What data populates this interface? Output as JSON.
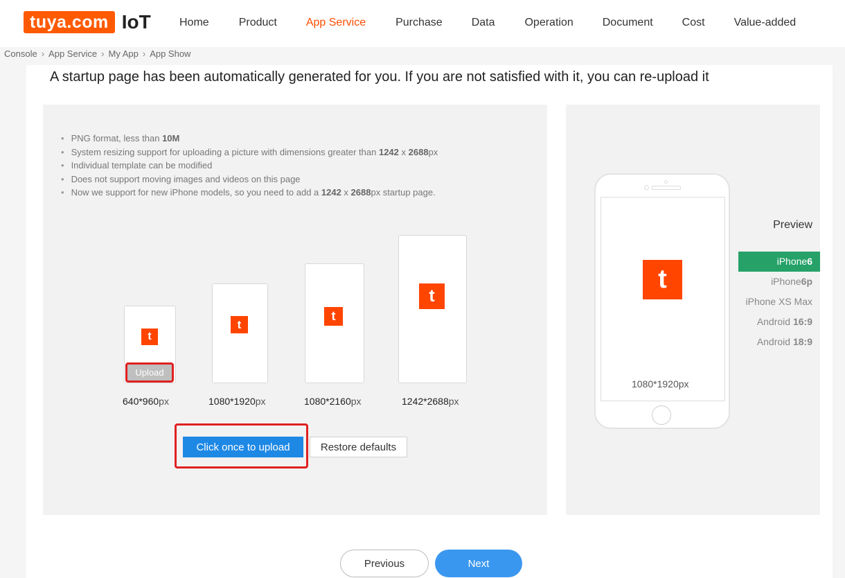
{
  "header": {
    "logo_text": "tuya.com",
    "logo_suffix": "IoT",
    "nav": [
      "Home",
      "Product",
      "App Service",
      "Purchase",
      "Data",
      "Operation",
      "Document",
      "Cost",
      "Value-added"
    ],
    "active_nav": "App Service"
  },
  "breadcrumb": [
    "Console",
    "App Service",
    "My App",
    "App Show"
  ],
  "headline": "A startup page has been automatically generated for you. If you are not satisfied with it, you can re-upload it",
  "tips": [
    {
      "pre": "PNG format, less than ",
      "bold": "10M",
      "post": ""
    },
    {
      "pre": "System resizing support for uploading a picture with dimensions greater than ",
      "bold": "1242",
      "post": " x ",
      "bold2": "2688",
      "post2": "px"
    },
    {
      "pre": "Individual template can be modified",
      "bold": "",
      "post": ""
    },
    {
      "pre": "Does not support moving images and videos on this page",
      "bold": "",
      "post": ""
    },
    {
      "pre": "Now we support for new iPhone models, so you need to add a ",
      "bold": "1242",
      "post": " x ",
      "bold2": "2688",
      "post2": "px startup page."
    }
  ],
  "templates": [
    {
      "size": "640*960",
      "unit": "px"
    },
    {
      "size": "1080*1920",
      "unit": "px"
    },
    {
      "size": "1080*2160",
      "unit": "px"
    },
    {
      "size": "1242*2688",
      "unit": "px"
    }
  ],
  "upload_chip": "Upload",
  "buttons": {
    "upload_once": "Click once to upload",
    "restore": "Restore defaults",
    "previous": "Previous",
    "next": "Next"
  },
  "preview": {
    "title": "Preview",
    "size_label": "1080*1920",
    "size_unit": "px",
    "devices": [
      {
        "label": "iPhone",
        "bold": "6"
      },
      {
        "label": "iPhone",
        "bold": "6p"
      },
      {
        "label": "iPhone XS Max",
        "bold": ""
      },
      {
        "label": "Android ",
        "bold": "16:9"
      },
      {
        "label": "Android ",
        "bold": "18:9"
      }
    ],
    "selected_index": 0
  },
  "colors": {
    "brand": "#ff5a00",
    "active_nav": "#ff4d00",
    "primary": "#1e88e5",
    "selected": "#26a269",
    "highlight": "#e02020"
  },
  "app_icon_glyph": "t"
}
